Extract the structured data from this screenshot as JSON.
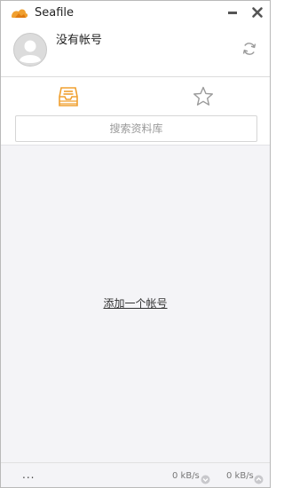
{
  "window": {
    "title": "Seafile"
  },
  "account": {
    "name": "没有帐号"
  },
  "search": {
    "placeholder": "搜索资料库"
  },
  "main": {
    "add_account_label": "添加一个帐号"
  },
  "status": {
    "more_label": "...",
    "download_rate": "0 kB/s",
    "upload_rate": "0 kB/s"
  },
  "colors": {
    "accent": "#f0a030",
    "muted": "#9a9a9a",
    "background": "#f4f4f7"
  }
}
